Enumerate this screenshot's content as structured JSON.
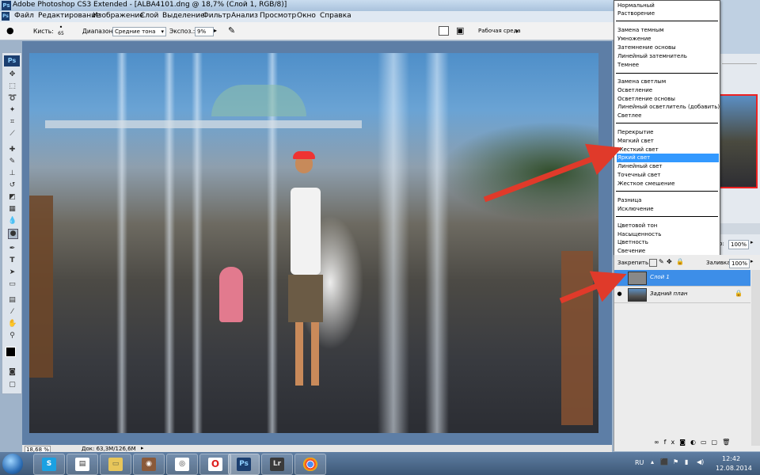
{
  "app": {
    "title": "Adobe Photoshop CS3 Extended - [ALBA4101.dng @ 18,7% (Слой 1, RGB/8)]"
  },
  "window_controls": {
    "minimize": "–",
    "maximize": "□",
    "close": "✕"
  },
  "menu": [
    "Файл",
    "Редактирование",
    "Изображение",
    "Слой",
    "Выделение",
    "Фильтр",
    "Анализ",
    "Просмотр",
    "Окно",
    "Справка"
  ],
  "options_bar": {
    "brush_label": "Кисть:",
    "brush_size": "65",
    "range_label": "Диапазон:",
    "range_value": "Средние тона",
    "exposure_label": "Экспоз.:",
    "exposure_value": "9%",
    "workspace_label": "Рабочая среда"
  },
  "status_bar": {
    "zoom": "18,68 %",
    "doc_info": "Док: 63,3М/126,6М"
  },
  "blend_modes": {
    "groups": [
      [
        "Нормальный",
        "Растворение"
      ],
      [
        "Замена темным",
        "Умножение",
        "Затемнение основы",
        "Линейный затемнитель",
        "Темнее"
      ],
      [
        "Замена светлым",
        "Осветление",
        "Осветление основы",
        "Линейный осветлитель (добавить)",
        "Светлее"
      ],
      [
        "Перекрытие",
        "Мягкий свет",
        "Жесткий свет",
        "Яркий свет",
        "Линейный свет",
        "Точечный свет",
        "Жесткое смешение"
      ],
      [
        "Разница",
        "Исключение"
      ],
      [
        "Цветовой тон",
        "Насыщенность",
        "Цветность",
        "Свечение"
      ]
    ],
    "selected": "Яркий свет"
  },
  "layers_panel": {
    "lock_label": "Закрепить:",
    "fill_label": "Заливка:",
    "fill_value": "100%",
    "opacity_value": "100%",
    "opacity_label_partial": "р:",
    "layers": [
      {
        "name": "Слой 1",
        "selected": true
      },
      {
        "name": "Задний план",
        "selected": false
      }
    ]
  },
  "taskbar": {
    "apps": [
      "Ps",
      "Lr"
    ],
    "lang": "RU",
    "time": "12:42",
    "date": "12.08.2014"
  },
  "colors": {
    "selection": "#3399ff",
    "arrow": "#e03a2a",
    "canvas_bg": "#5d7ea6"
  }
}
